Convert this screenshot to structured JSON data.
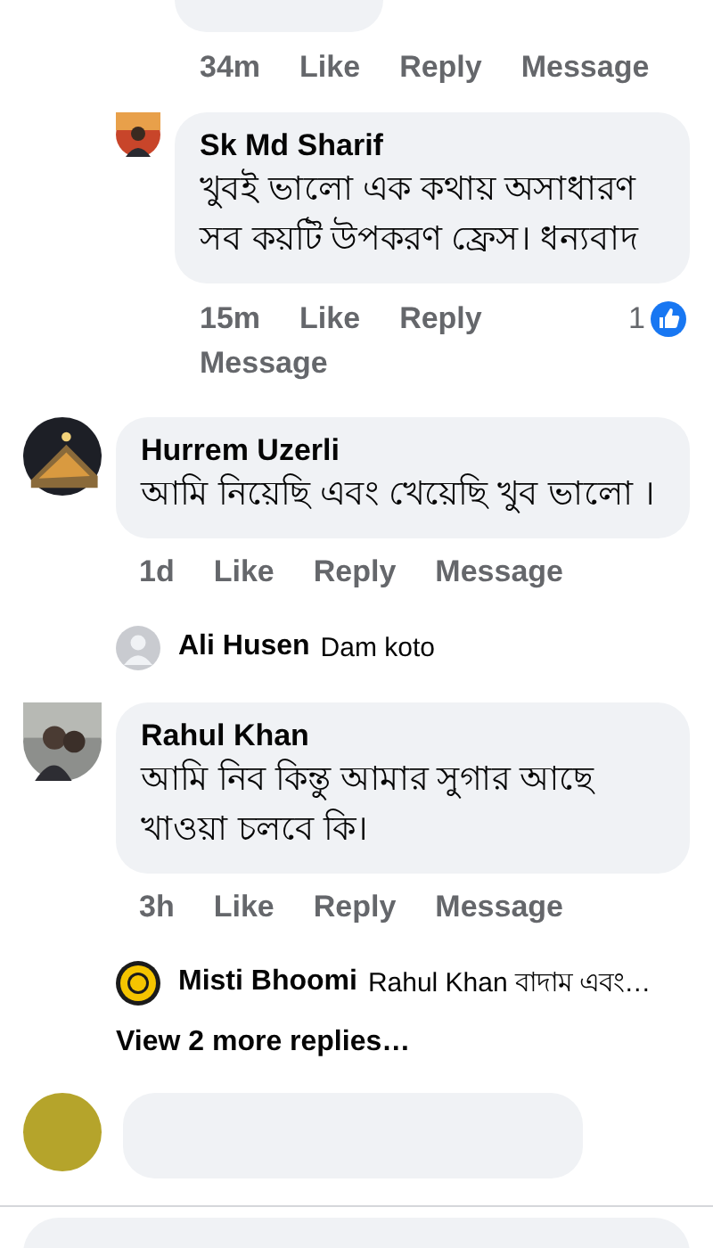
{
  "earlier_replies": [
    {
      "kind": "cut",
      "time": "34m",
      "actions": [
        "Like",
        "Reply",
        "Message"
      ]
    },
    {
      "kind": "full",
      "author": "Sk Md Sharif",
      "text": "খুবই ভালো এক কথায় অসাধারণ সব কয়টি উপকরণ ফ্রেস। ধন্যবাদ",
      "time": "15m",
      "actions": [
        "Like",
        "Reply",
        "Message"
      ],
      "reactions": "1"
    }
  ],
  "comments": [
    {
      "kind": "full",
      "author": "Hurrem Uzerli",
      "text": "আমি নিয়েছি এবং খেয়েছি খুব ভালো ।",
      "time": "1d",
      "actions": [
        "Like",
        "Reply",
        "Message"
      ],
      "replies": [
        {
          "author": "Ali Husen",
          "text": "Dam koto"
        }
      ]
    },
    {
      "kind": "full",
      "author": "Rahul Khan",
      "text": "আমি নিব কিন্তু আমার সুগার আছে খাওয়া চলবে কি।",
      "time": "3h",
      "actions": [
        "Like",
        "Reply",
        "Message"
      ],
      "replies": [
        {
          "author": "Misti Bhoomi",
          "text": "Rahul Khan বাদাম এবং…"
        }
      ],
      "more_replies": "View 2 more replies…"
    },
    {
      "kind": "cut"
    }
  ],
  "composer": {
    "kind": "field"
  }
}
